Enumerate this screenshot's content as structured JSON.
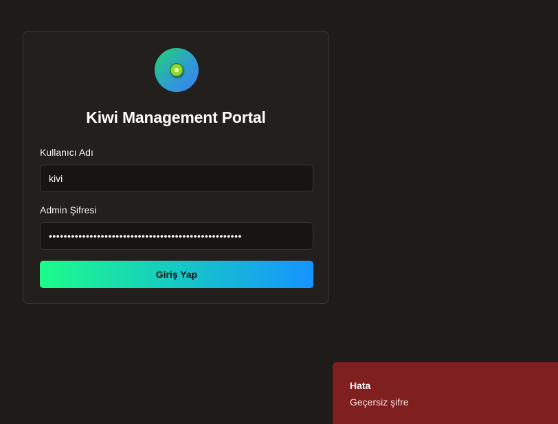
{
  "login": {
    "title": "Kiwi Management Portal",
    "logo_icon": "kiwi-icon",
    "username_label": "Kullanıcı Adı",
    "username_value": "kivi",
    "password_label": "Admin Şifresi",
    "password_value": "••••••••••••••••••••••••••••••••••••••••••••••••••••",
    "submit_label": "Giriş Yap"
  },
  "toast": {
    "title": "Hata",
    "message": "Geçersiz şifre"
  },
  "colors": {
    "background": "#1f1b19",
    "card": "#221f1d",
    "button_gradient_start": "#1dfc8a",
    "button_gradient_end": "#1694ff",
    "error": "#7f1f1f"
  }
}
